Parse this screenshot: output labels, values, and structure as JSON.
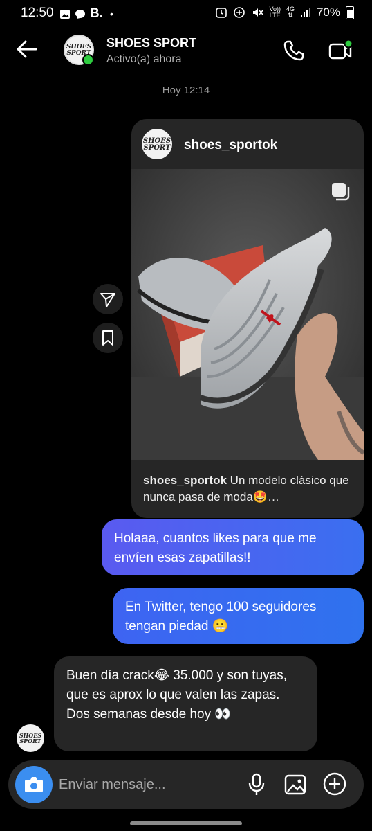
{
  "status_bar": {
    "time": "12:50",
    "carrier_icon": "B.",
    "dot": "•",
    "network_top": "Vo))",
    "network_bottom": "LTE",
    "network2_top": "4G",
    "network2_bottom": "",
    "battery": "70%"
  },
  "header": {
    "title": "SHOES SPORT",
    "status": "Activo(a) ahora",
    "avatar_logo": "SHOES SPORT",
    "online_color": "#2ecc40"
  },
  "timestamp": "Hoy 12:14",
  "post": {
    "username": "shoes_sportok",
    "caption_user": "shoes_sportok",
    "caption_text": " Un modelo clásico que nunca pasa de moda🤩…",
    "logo": "SHOES SPORT"
  },
  "messages": [
    {
      "text": "Holaaa, cuantos likes para que me envíen esas zapatillas!!",
      "direction": "out"
    },
    {
      "text": "En Twitter, tengo 100 seguidores tengan piedad 😬",
      "direction": "out"
    },
    {
      "text": "Buen día crack😂 35.000 y son tuyas, que es aprox lo que valen las zapas. Dos semanas desde hoy 👀",
      "direction": "in"
    }
  ],
  "composer": {
    "placeholder": "Enviar mensaje..."
  },
  "icons": {
    "back": "back-arrow-icon",
    "call": "phone-icon",
    "video": "video-camera-icon",
    "share": "send-icon",
    "save": "bookmark-icon",
    "multi": "carousel-icon",
    "camera": "camera-icon",
    "mic": "microphone-icon",
    "gallery": "image-icon",
    "plus": "plus-icon"
  },
  "colors": {
    "accent": "#3b8ef0",
    "bubble_out": "#4a62f0",
    "bubble_in": "#262626"
  }
}
